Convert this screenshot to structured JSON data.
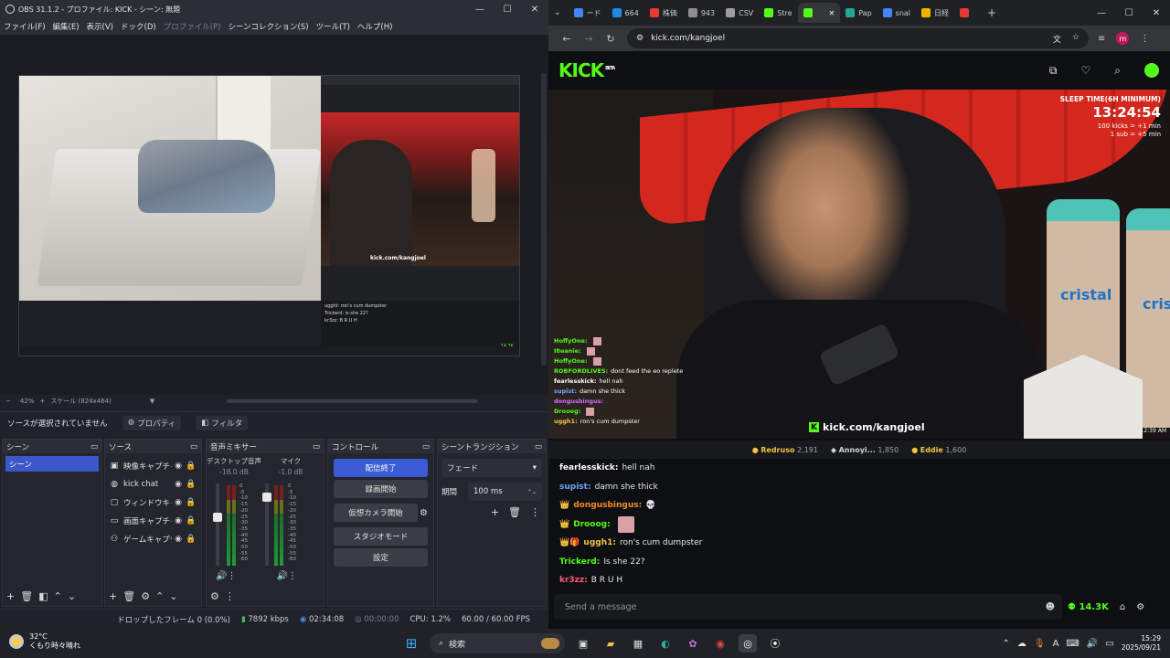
{
  "obs": {
    "title": "OBS 31.1.2 - プロファイル: KICK - シーン: 無題",
    "menu": [
      "ファイル(F)",
      "編集(E)",
      "表示(V)",
      "ドック(D)",
      "プロファイル(P)",
      "シーンコレクション(S)",
      "ツール(T)",
      "ヘルプ(H)"
    ],
    "zoom": "42%",
    "scale_label": "スケール (824x464)",
    "no_source": "ソースが選択されていません",
    "properties": "プロパティ",
    "filters": "フィルタ",
    "docks": {
      "scenes": {
        "title": "シーン",
        "items": [
          "シーン"
        ]
      },
      "sources": {
        "title": "ソース",
        "items": [
          {
            "icon": "camera-icon",
            "name": "映像キャプチャ"
          },
          {
            "icon": "globe-icon",
            "name": "kick chat"
          },
          {
            "icon": "window-icon",
            "name": "ウィンドウキャ"
          },
          {
            "icon": "monitor-icon",
            "name": "画面キャプチャ"
          },
          {
            "icon": "gamepad-icon",
            "name": "ゲームキャプチ"
          }
        ]
      },
      "mixer": {
        "title": "音声ミキサー",
        "channels": [
          {
            "name": "デスクトップ音声",
            "db": "-18.0 dB",
            "level": 0.6
          },
          {
            "name": "マイク",
            "db": "-1.0 dB",
            "level": 0.88
          }
        ],
        "scale": [
          "0",
          "-5",
          "-10",
          "-15",
          "-20",
          "-25",
          "-30",
          "-35",
          "-40",
          "-45",
          "-50",
          "-55",
          "-60"
        ]
      },
      "controls": {
        "title": "コントロール",
        "stop_stream": "配信終了",
        "record": "録画開始",
        "virtual_cam": "仮想カメラ開始",
        "studio": "スタジオモード",
        "settings": "設定"
      },
      "transitions": {
        "title": "シーントランジション",
        "selected": "フェード",
        "duration_label": "期間",
        "duration": "100 ms"
      }
    },
    "status": {
      "dropped": "ドロップしたフレーム 0 (0.0%)",
      "bitrate": "7892 kbps",
      "stream_time": "02:34:08",
      "rec_time": "00:00:00",
      "cpu": "CPU: 1.2%",
      "fps": "60.00 / 60.00 FPS"
    },
    "preview": {
      "mini_chat": [
        "ugght: ron's cum dumpster",
        "Trickerd: is she 22?",
        "kr3zz: B R U H"
      ],
      "mini_url": "kick.com/kangjoel",
      "mini_count": "14.3K"
    }
  },
  "browser": {
    "tabs": [
      {
        "label": "ード",
        "color": "#4285f4"
      },
      {
        "label": "664",
        "color": "#1e88e5"
      },
      {
        "label": "株価",
        "color": "#e53935"
      },
      {
        "label": "943",
        "color": "#8e8e8e"
      },
      {
        "label": "CSV",
        "color": "#9e9e9e"
      },
      {
        "label": "Stre",
        "color": "#53fc18"
      },
      {
        "label": "",
        "color": "#53fc18",
        "active": true
      },
      {
        "label": "Pap",
        "color": "#26a69a"
      },
      {
        "label": "snal",
        "color": "#4285f4"
      },
      {
        "label": "日経",
        "color": "#f0b400"
      },
      {
        "label": "",
        "color": "#e53935"
      }
    ],
    "url": "kick.com/kangjoel"
  },
  "kick": {
    "logo": "KICK",
    "beta": "BETA",
    "overlay": {
      "sleep_title": "SLEEP TIME(6H MINIMUM)",
      "timer": "13:24:54",
      "kicks": "100 kicks = +1 min",
      "subs": "1 sub = +5 min",
      "url": "kick.com/kangjoel",
      "clock": "12:39 AM"
    },
    "overlay_chat": [
      {
        "user": "HoffyOne:",
        "text": "",
        "color": "#53fc18",
        "emote": true
      },
      {
        "user": "I8eanie:",
        "text": "",
        "color": "#53fc18",
        "emote": true
      },
      {
        "user": "HoffyOne:",
        "text": "",
        "color": "#53fc18",
        "emote": true
      },
      {
        "user": "ROBFORDLIVES:",
        "text": "dont feed the eo replete",
        "color": "#53fc18"
      },
      {
        "user": "fearlesskick:",
        "text": "hell nah",
        "color": "#ffffff"
      },
      {
        "user": "supist:",
        "text": "damn she thick",
        "color": "#6fa8ff"
      },
      {
        "user": "dongusbingus:",
        "text": "",
        "color": "#d76cff"
      },
      {
        "user": "Drooog:",
        "text": "",
        "color": "#53fc18",
        "emote": true
      },
      {
        "user": "uggh1:",
        "text": "ron's cum dumpster",
        "color": "#f6c344"
      }
    ],
    "leaderboard": [
      {
        "name": "Redruso",
        "value": "2,191"
      },
      {
        "name": "Annoyi...",
        "value": "1,850"
      },
      {
        "name": "Eddie",
        "value": "1,600"
      }
    ],
    "chat": [
      {
        "user": "fearlesskick:",
        "text": "hell nah",
        "color": "#ffffff",
        "badge": ""
      },
      {
        "user": "supist:",
        "text": "damn she thick",
        "color": "#6fa8ff",
        "badge": ""
      },
      {
        "user": "dongusbingus:",
        "text": "💀",
        "color": "#f28c28",
        "badge": "👑"
      },
      {
        "user": "Drooog:",
        "text": "",
        "color": "#53fc18",
        "badge": "👑",
        "emote": true
      },
      {
        "user": "uggh1:",
        "text": "ron's cum dumpster",
        "color": "#f6c344",
        "badge": "👑🎁"
      },
      {
        "user": "Trickerd:",
        "text": "Is she 22?",
        "color": "#53fc18",
        "badge": ""
      },
      {
        "user": "kr3zz:",
        "text": "B R U H",
        "color": "#ff5c7a",
        "badge": ""
      }
    ],
    "send_placeholder": "Send a message",
    "viewer_count": "14.3K"
  },
  "taskbar": {
    "weather_temp": "32°C",
    "weather_desc": "くもり時々晴れ",
    "search": "検索",
    "time": "15:29",
    "date": "2025/09/21"
  }
}
